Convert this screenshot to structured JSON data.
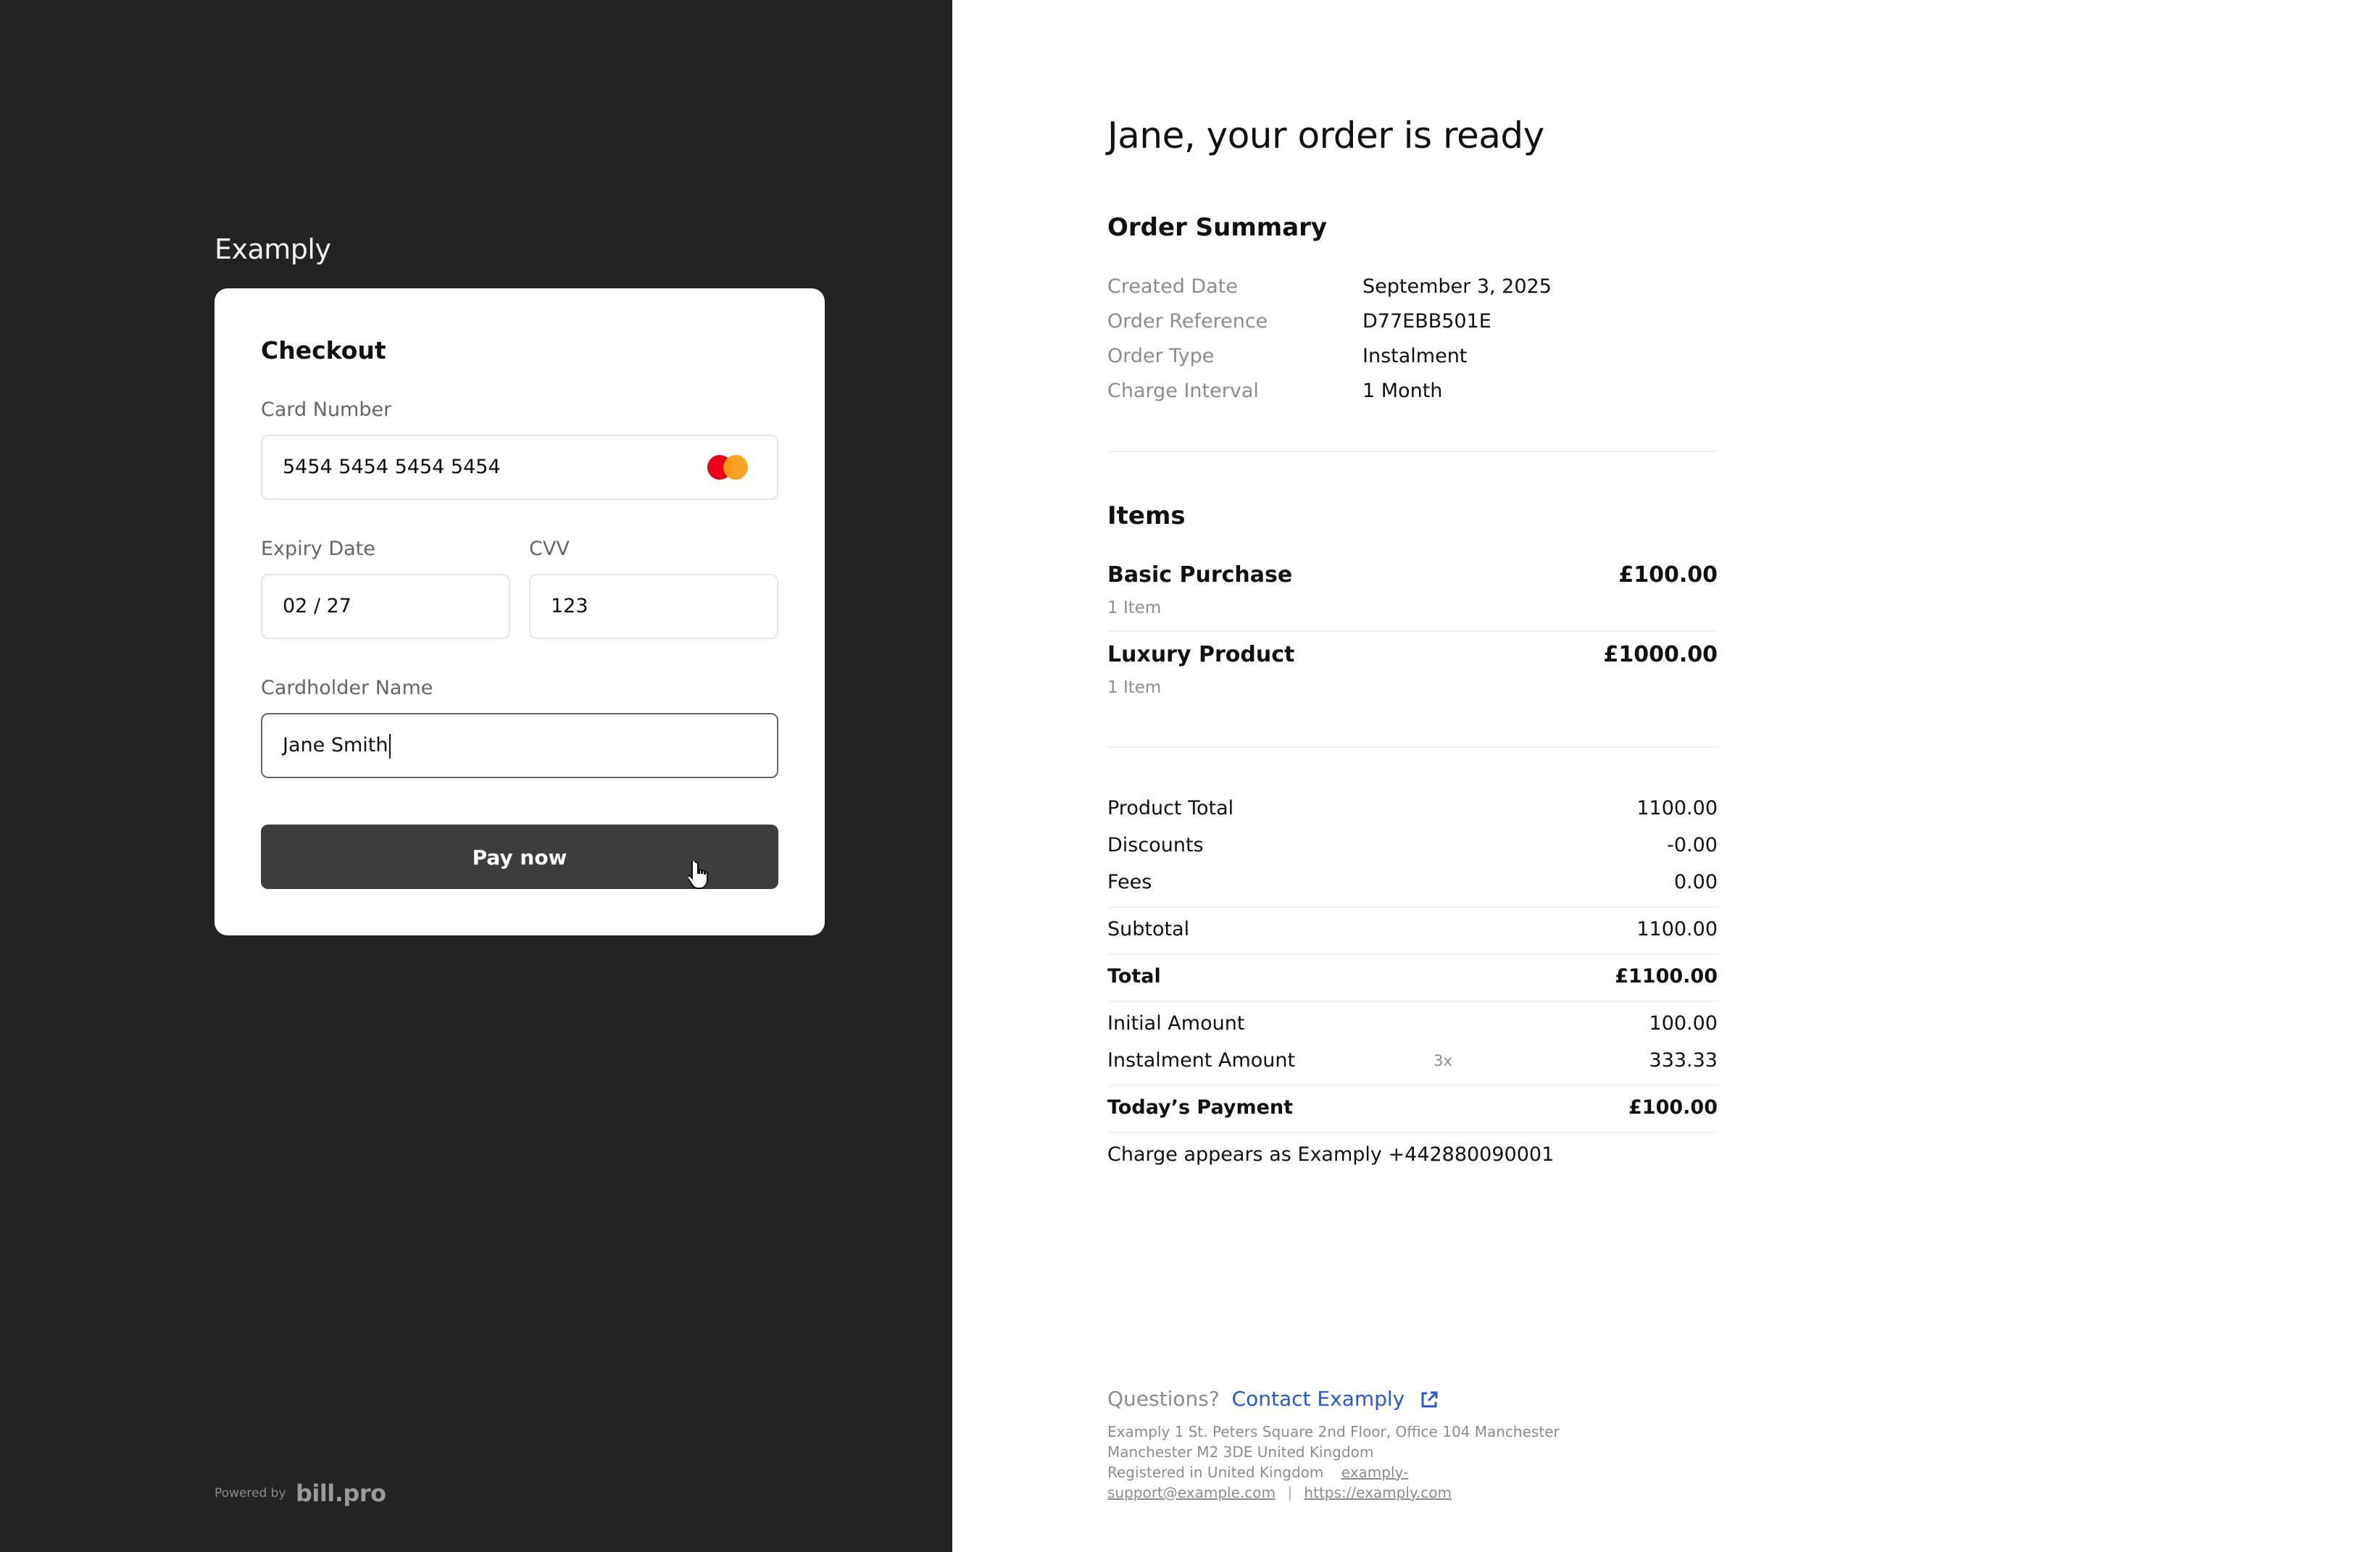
{
  "brand": {
    "name": "Examply"
  },
  "checkout": {
    "title": "Checkout",
    "card_number_label": "Card Number",
    "card_number_value": "5454 5454 5454 5454",
    "card_brand_icon": "mastercard-icon",
    "expiry_label": "Expiry Date",
    "expiry_value": "02 / 27",
    "cvv_label": "CVV",
    "cvv_value": "123",
    "cardholder_label": "Cardholder Name",
    "cardholder_value": "Jane Smith",
    "pay_button": "Pay now"
  },
  "powered_by": {
    "label": "Powered by",
    "logo": "bill.pro"
  },
  "order": {
    "headline": "Jane, your order is ready",
    "summary_title": "Order Summary",
    "summary": [
      {
        "label": "Created Date",
        "value": "September 3, 2025"
      },
      {
        "label": "Order Reference",
        "value": "D77EBB501E"
      },
      {
        "label": "Order Type",
        "value": "Instalment"
      },
      {
        "label": "Charge Interval",
        "value": "1 Month"
      }
    ],
    "items_title": "Items",
    "items": [
      {
        "name": "Basic Purchase",
        "qty": "1 Item",
        "price": "£100.00"
      },
      {
        "name": "Luxury Product",
        "qty": "1 Item",
        "price": "£1000.00"
      }
    ],
    "totals": {
      "product_total": {
        "label": "Product Total",
        "value": "1100.00"
      },
      "discounts": {
        "label": "Discounts",
        "value": "-0.00"
      },
      "fees": {
        "label": "Fees",
        "value": "0.00"
      },
      "subtotal": {
        "label": "Subtotal",
        "value": "1100.00"
      },
      "total": {
        "label": "Total",
        "value": "£1100.00"
      },
      "initial": {
        "label": "Initial Amount",
        "value": "100.00"
      },
      "instalment": {
        "label": "Instalment Amount",
        "multiplier": "3x",
        "value": "333.33"
      },
      "today": {
        "label": "Today’s Payment",
        "value": "£100.00"
      }
    },
    "charge_note": "Charge appears as Examply +442880090001"
  },
  "footer": {
    "questions": "Questions?",
    "contact_link": "Contact Examply",
    "address_line1": "Examply 1 St. Peters Square 2nd Floor, Office 104 Manchester",
    "address_line2": "Manchester M2 3DE United Kingdom",
    "registered": "Registered in United Kingdom",
    "email_part1": "examply-",
    "email_part2": "support@example.com",
    "separator": "|",
    "website": "https://examply.com"
  },
  "colors": {
    "left_panel": "#232325",
    "pay_button": "#3d3d3d",
    "link": "#2a56d6"
  }
}
